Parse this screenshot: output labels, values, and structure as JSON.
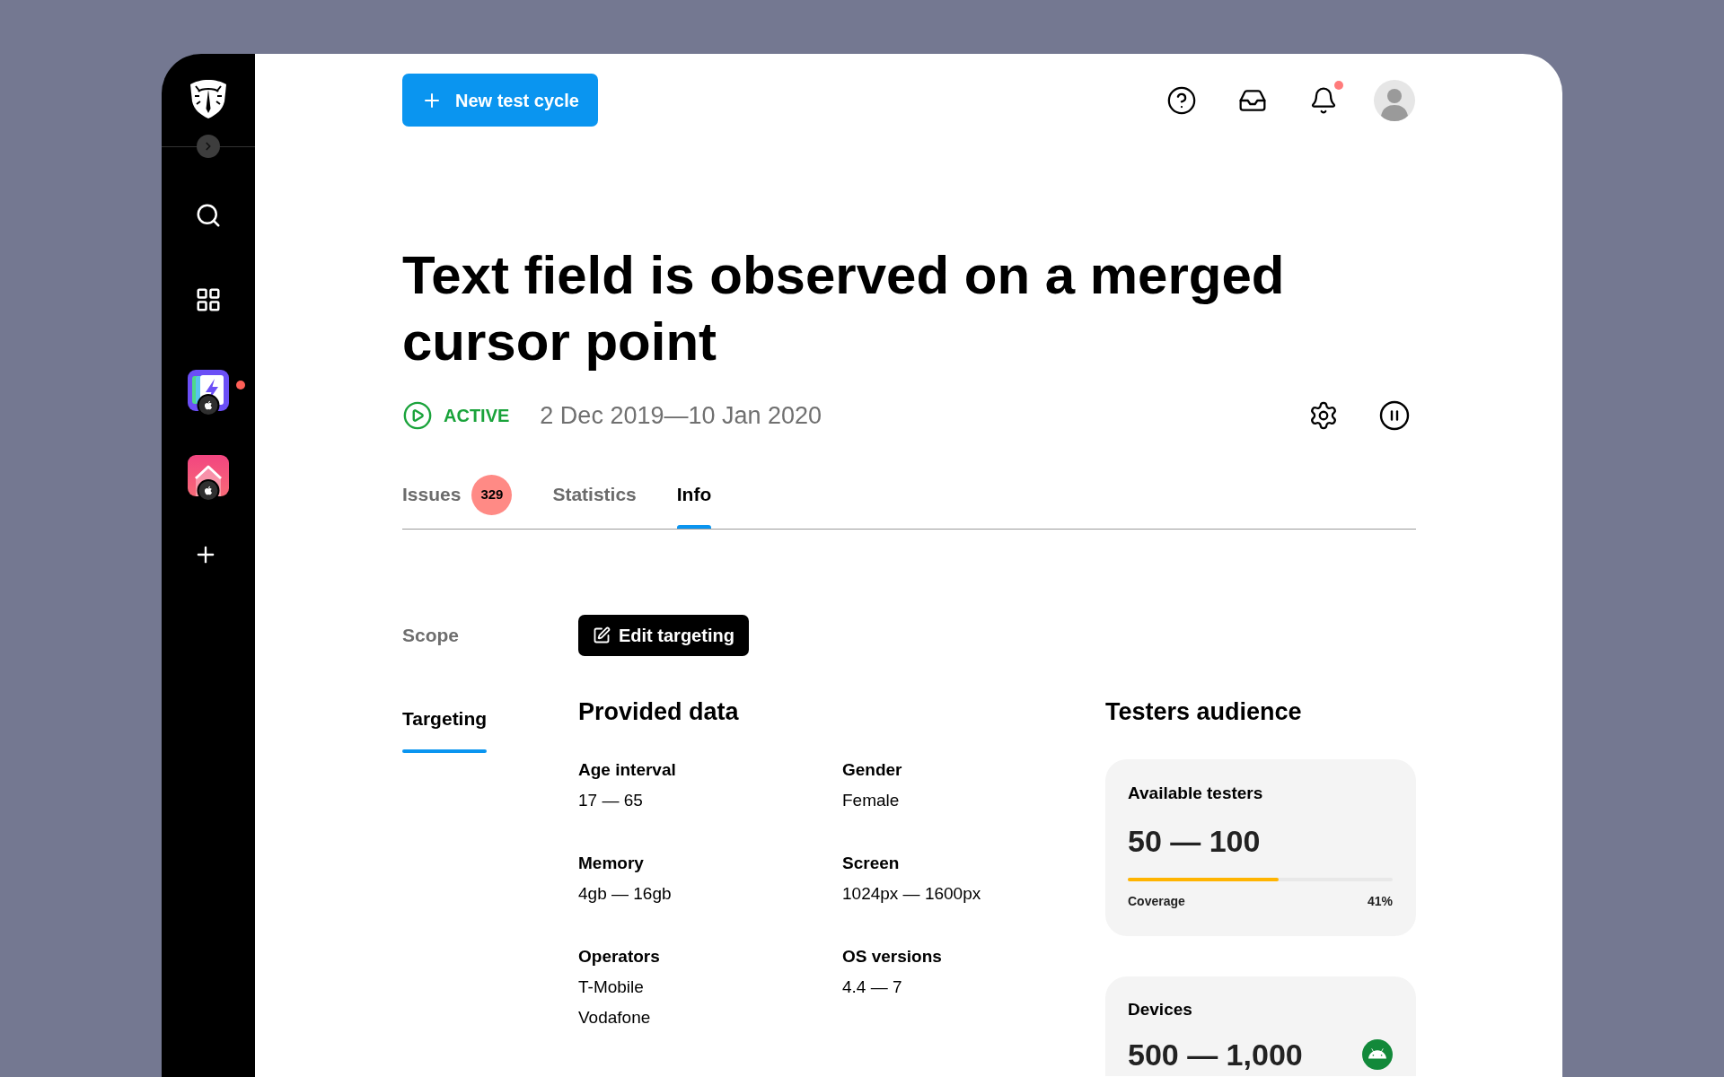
{
  "sidebar": {
    "apps": [
      {
        "kind": "bolt",
        "badge": {
          "kind": "apple"
        },
        "unread": true
      },
      {
        "kind": "chevron",
        "badge": {
          "kind": "apple"
        },
        "unread": false
      }
    ]
  },
  "header": {
    "new_button": "New test cycle",
    "notifications": {
      "unread": true
    }
  },
  "title": "Text field is observed on a merged cursor point",
  "status": {
    "kind": "active",
    "label": "ACTIVE",
    "date_range": "2 Dec 2019—10 Jan 2020"
  },
  "tabs": [
    {
      "label": "Issues",
      "count": "329",
      "selected": false
    },
    {
      "label": "Statistics",
      "selected": false
    },
    {
      "label": "Info",
      "selected": true
    }
  ],
  "side_tabs": [
    {
      "label": "Scope",
      "selected": false
    },
    {
      "label": "Targeting",
      "selected": true
    }
  ],
  "edit_button": "Edit targeting",
  "provided_data": {
    "title": "Provided data",
    "fields": [
      {
        "label": "Age interval",
        "values": [
          "17 — 65"
        ]
      },
      {
        "label": "Gender",
        "values": [
          "Female"
        ]
      },
      {
        "label": "Memory",
        "values": [
          "4gb — 16gb"
        ]
      },
      {
        "label": "Screen",
        "values": [
          "1024px — 1600px"
        ]
      },
      {
        "label": "Operators",
        "values": [
          "T-Mobile",
          "Vodafone"
        ]
      },
      {
        "label": "OS versions",
        "values": [
          "4.4 — 7"
        ]
      }
    ]
  },
  "testers_audience": {
    "title": "Testers audience",
    "cards": [
      {
        "title": "Available testers",
        "value": "50 — 100",
        "coverage": {
          "label": "Coverage",
          "reading": "41%",
          "level": 0.57
        }
      },
      {
        "title": "Devices",
        "value": "500 — 1,000",
        "badge": {
          "kind": "android"
        }
      }
    ]
  }
}
